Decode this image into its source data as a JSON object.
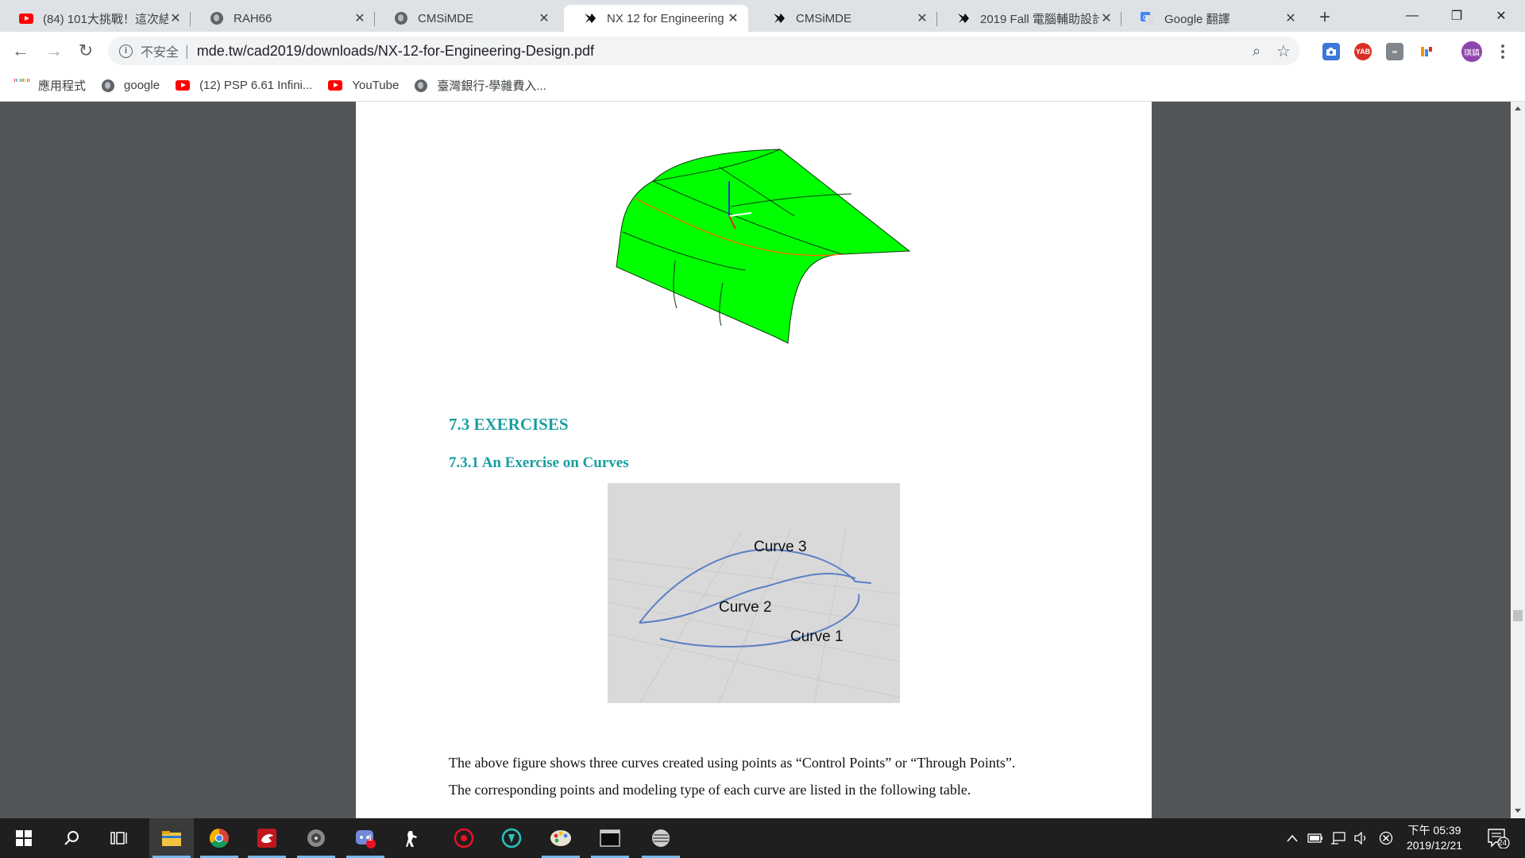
{
  "browser": {
    "tabs": [
      {
        "title": "(84) 101大挑戰！這次結",
        "favicon": "youtube-icon"
      },
      {
        "title": "RAH66",
        "favicon": "globe-icon"
      },
      {
        "title": "CMSiMDE",
        "favicon": "globe-icon"
      },
      {
        "title": "NX 12 for Engineering",
        "favicon": "siemens-nx-icon",
        "active": true
      },
      {
        "title": "CMSiMDE",
        "favicon": "siemens-nx-icon"
      },
      {
        "title": "2019 Fall 電腦輔助設計",
        "favicon": "siemens-nx-icon"
      },
      {
        "title": "Google 翻譯",
        "favicon": "google-translate-icon"
      }
    ],
    "new_tab": "+",
    "window_controls": {
      "minimize": "—",
      "restore": "❐",
      "close": "✕"
    },
    "toolbar": {
      "back": "←",
      "forward": "→",
      "reload": "↻",
      "security_text": "不安全",
      "divider": "|",
      "url": "mde.tw/cad2019/downloads/NX-12-for-Engineering-Design.pdf",
      "zoom_icon": "⌕",
      "star_icon": "☆",
      "profile_label": "琪鎮",
      "extensions": [
        "camera-extension-icon",
        "yab-extension-icon",
        "infinity-extension-icon",
        "feedly-extension-icon"
      ],
      "ext_yab_label": "YAB"
    },
    "bookmarks": [
      {
        "label": "應用程式",
        "icon": "apps-grid-icon"
      },
      {
        "label": "google",
        "icon": "globe-icon"
      },
      {
        "label": "(12) PSP 6.61 Infini...",
        "icon": "youtube-icon"
      },
      {
        "label": "YouTube",
        "icon": "youtube-icon"
      },
      {
        "label": "臺灣銀行-學雜費入...",
        "icon": "globe-icon"
      }
    ]
  },
  "document": {
    "section_heading": "7.3 EXERCISES",
    "subsection_heading": "7.3.1 An Exercise on Curves",
    "figure_labels": {
      "curve3": "Curve 3",
      "curve2": "Curve 2",
      "curve1": "Curve 1"
    },
    "paragraph_line1": "The above figure shows three curves created using points as “Control Points” or “Through Points”.",
    "paragraph_line2": "The corresponding points and modeling type of each curve are listed in the following table.",
    "surface_color": "#00ff00",
    "heading_color": "#1a9ea0",
    "curve_color": "#5b7fc4"
  },
  "taskbar": {
    "items": [
      "windows-start-icon",
      "search-icon",
      "task-view-icon",
      "file-explorer-icon",
      "chrome-icon",
      "garena-icon",
      "app-icon",
      "discord-icon",
      "counter-strike-icon",
      "anti-virus-icon",
      "teamspeak-icon",
      "paint-icon",
      "terminal-icon",
      "sphere-app-icon"
    ],
    "discord_badge": "1",
    "clock_period_time": "下午 05:39",
    "date": "2019/12/21",
    "notification_count": "24"
  }
}
